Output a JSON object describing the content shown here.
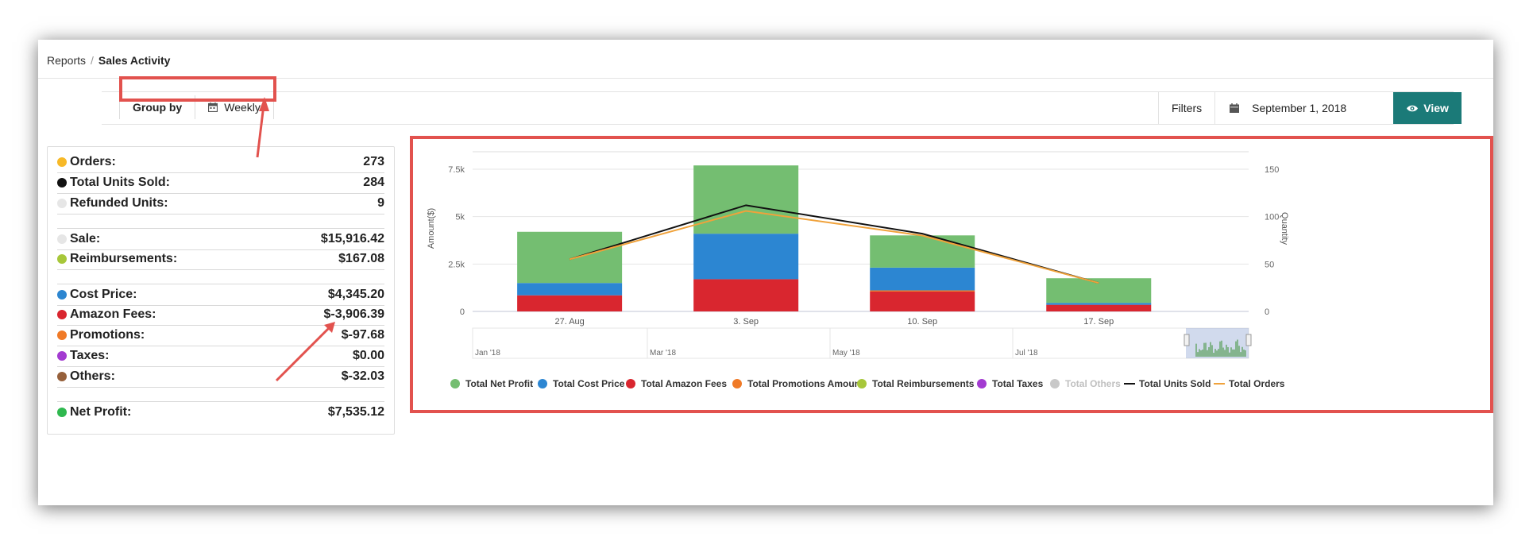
{
  "breadcrumb": {
    "parent": "Reports",
    "separator": "/",
    "current": "Sales Activity"
  },
  "toolbar": {
    "group_by_label": "Group by",
    "group_by_value": "Weekly",
    "filters_label": "Filters",
    "date_value": "September 1, 2018",
    "view_label": "View",
    "accent_color": "#1b7a78",
    "highlight_color": "#e2524e"
  },
  "summary": {
    "rows": [
      {
        "label": "Orders:",
        "value": "273",
        "color": "#f7b928"
      },
      {
        "label": "Total Units Sold:",
        "value": "284",
        "color": "#111111"
      },
      {
        "label": "Refunded Units:",
        "value": "9",
        "color": "#e6e6e6"
      },
      {
        "label": "Sale:",
        "value": "$15,916.42",
        "color": "#e6e6e6"
      },
      {
        "label": "Reimbursements:",
        "value": "$167.08",
        "color": "#a7c73a"
      },
      {
        "label": "Cost Price:",
        "value": "$4,345.20",
        "color": "#2d86d0"
      },
      {
        "label": "Amazon Fees:",
        "value": "$-3,906.39",
        "color": "#d9262f"
      },
      {
        "label": "Promotions:",
        "value": "$-97.68",
        "color": "#f07a27"
      },
      {
        "label": "Taxes:",
        "value": "$0.00",
        "color": "#a33bd1"
      },
      {
        "label": "Others:",
        "value": "$-32.03",
        "color": "#96603b"
      },
      {
        "label": "Net Profit:",
        "value": "$7,535.12",
        "color": "#2fb84f"
      }
    ]
  },
  "chart_data": {
    "type": "bar",
    "categories": [
      "27. Aug",
      "3. Sep",
      "10. Sep",
      "17. Sep"
    ],
    "ylabel": "Amount($)",
    "ylabel_right": "Quantity",
    "ylim": [
      0,
      7500
    ],
    "yticks": [
      "0",
      "2.5k",
      "5k",
      "7.5k"
    ],
    "ylim_right": [
      0,
      150
    ],
    "yticks_right": [
      "0",
      "50",
      "100",
      "150"
    ],
    "stacked": true,
    "series": [
      {
        "name": "Total Net Profit",
        "kind": "bar",
        "color": "#74be71",
        "values": [
          2700,
          3600,
          1700,
          1300
        ]
      },
      {
        "name": "Total Cost Price",
        "kind": "bar",
        "color": "#2c86d2",
        "values": [
          650,
          2400,
          1200,
          100
        ]
      },
      {
        "name": "Total Amazon Fees",
        "kind": "bar",
        "color": "#d9262f",
        "values": [
          850,
          1700,
          1050,
          350
        ]
      },
      {
        "name": "Total Promotions Amount",
        "kind": "bar",
        "color": "#f07a27",
        "values": [
          0,
          0,
          60,
          0
        ]
      },
      {
        "name": "Total Reimbursements",
        "kind": "bar",
        "color": "#a7c73a",
        "values": [
          0,
          0,
          0,
          0
        ]
      },
      {
        "name": "Total Taxes",
        "kind": "bar",
        "color": "#a33bd1",
        "values": [
          0,
          0,
          0,
          0
        ]
      },
      {
        "name": "Total Others",
        "kind": "bar",
        "color": "#c8c8c8",
        "values": [
          0,
          0,
          0,
          0
        ],
        "hidden": true
      },
      {
        "name": "Total Units Sold",
        "kind": "line",
        "axis": "right",
        "color": "#111111",
        "values": [
          55,
          112,
          82,
          30
        ]
      },
      {
        "name": "Total Orders",
        "kind": "line",
        "axis": "right",
        "color": "#f0a23b",
        "values": [
          55,
          106,
          80,
          30
        ]
      }
    ],
    "navigator_labels": [
      "Jan '18",
      "Mar '18",
      "May '18",
      "Jul '18"
    ],
    "legend_position": "bottom",
    "grid": true
  }
}
